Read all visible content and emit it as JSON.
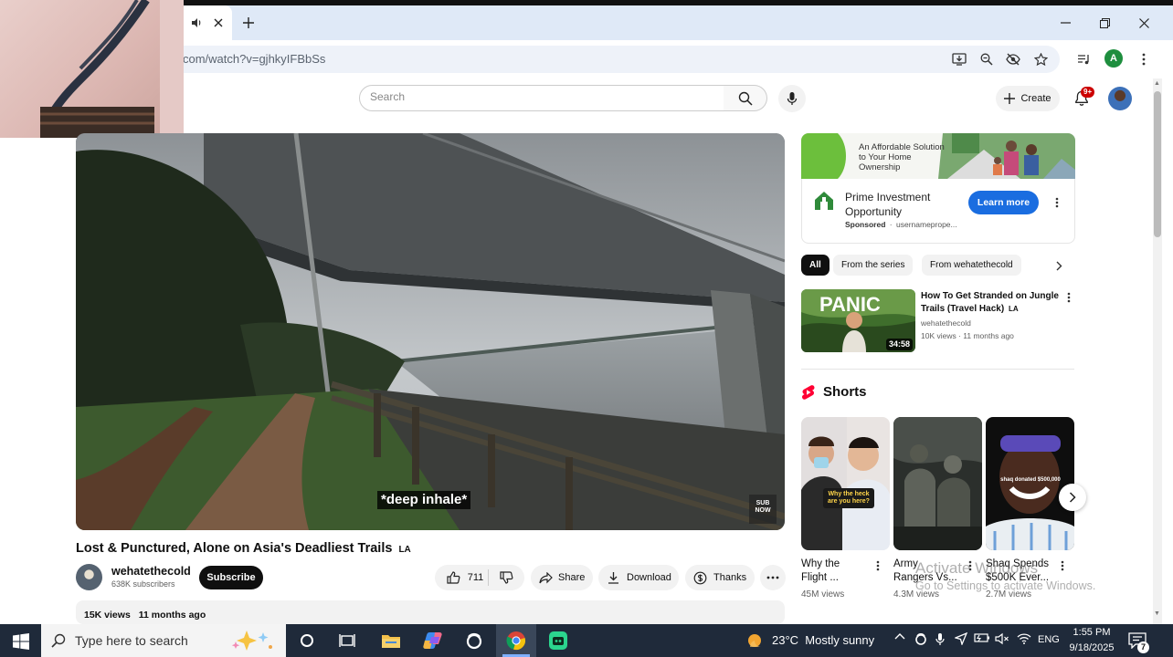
{
  "browser": {
    "url": "com/watch?v=gjhkyIFBbSs",
    "profile_initial": "A"
  },
  "youtube": {
    "search_placeholder": "Search",
    "create_label": "Create",
    "notif_badge": "9+"
  },
  "video": {
    "caption": "*deep inhale*",
    "watermark": "SUB\nNOW",
    "title": "Lost & Punctured, Alone on Asia's Deadliest Trails",
    "title_badge": "LA",
    "channel": "wehatethecold",
    "subscribers": "638K subscribers",
    "subscribe_label": "Subscribe",
    "likes": "711",
    "share_label": "Share",
    "download_label": "Download",
    "thanks_label": "Thanks",
    "views": "15K views",
    "age": "11 months ago"
  },
  "sidebar": {
    "ad": {
      "banner_text": "An Affordable Solution to Your Home Ownership",
      "name": "Prime Investment Opportunity",
      "sponsored": "Sponsored",
      "domain": "usernameprope...",
      "cta": "Learn more"
    },
    "chips": [
      "All",
      "From the series",
      "From wehatethecold"
    ],
    "recommended": {
      "thumb_text": "PANIC",
      "duration": "34:58",
      "title": "How To Get Stranded on Jungle Trails (Travel Hack)",
      "title_badge": "LA",
      "channel": "wehatethecold",
      "meta": "10K views · 11 months ago"
    },
    "shorts_label": "Shorts",
    "shorts": [
      {
        "title_line1": "Why the",
        "title_line2": "Flight ...",
        "views": "45M views",
        "overlay": "Why the heck are you here?"
      },
      {
        "title_line1": "Army",
        "title_line2": "Rangers Vs...",
        "views": "4.3M views"
      },
      {
        "title_line1": "Shaq Spends",
        "title_line2": "$500K Ever...",
        "views": "2.7M views",
        "overlay": "shaq donated $500,000"
      }
    ]
  },
  "windows_overlay": {
    "line1": "Activate Windows",
    "line2": "Go to Settings to activate Windows."
  },
  "taskbar": {
    "search_placeholder": "Type here to search",
    "weather": "23°C  Mostly sunny",
    "language": "ENG",
    "time": "1:55 PM",
    "date": "9/18/2025",
    "notification_count": "7"
  }
}
